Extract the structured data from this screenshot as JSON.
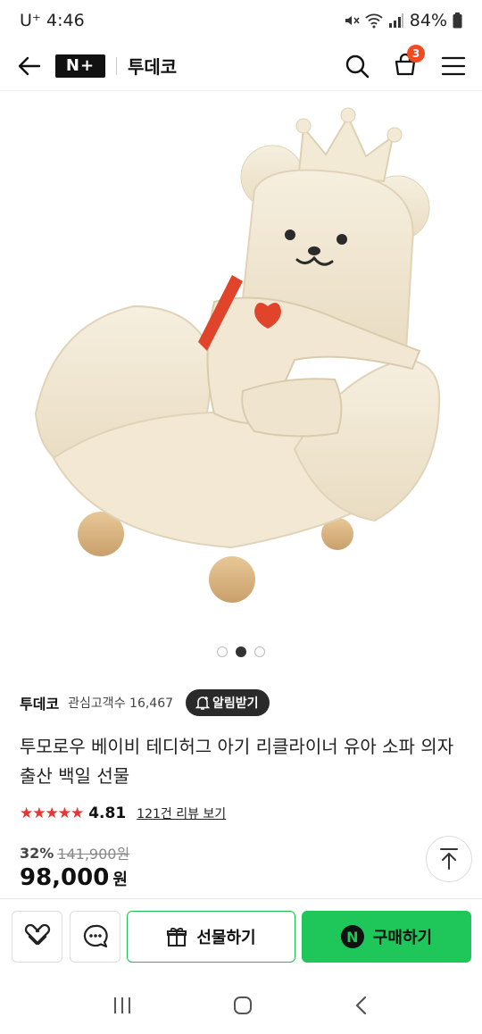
{
  "status": {
    "carrier": "U⁺",
    "time": "4:46",
    "battery": "84%"
  },
  "header": {
    "logo": "N+",
    "store": "투데코",
    "cart_count": "3"
  },
  "carousel": {
    "total": 3,
    "active_index": 1
  },
  "seller": {
    "name": "투데코",
    "interest_label": "관심고객수",
    "interest_count": "16,467",
    "notify_label": "알림받기"
  },
  "product": {
    "title": "투모로우 베이비 테디허그 아기 리클라이너 유아 소파 의자 출산 백일 선물",
    "stars": "★★★★★",
    "rating": "4.81",
    "review_link": "121건 리뷰 보기",
    "discount": "32%",
    "original_price": "141,900원",
    "price": "98,000",
    "currency": "원"
  },
  "actions": {
    "gift_label": "선물하기",
    "buy_label": "구매하기",
    "buy_logo": "N"
  },
  "colors": {
    "accent_green": "#1fc75a",
    "badge_red": "#f04b23",
    "star_red": "#e53535"
  }
}
